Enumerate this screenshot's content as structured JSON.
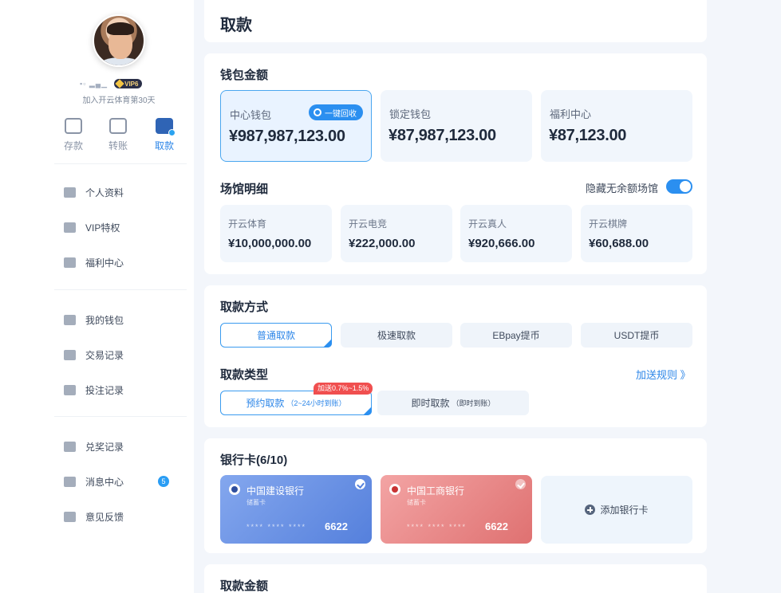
{
  "profile": {
    "username": "▪▫ ▂▄▁",
    "vip_label": "VIP6",
    "join_text": "加入开云体育第30天"
  },
  "quick_actions": [
    {
      "label": "存款",
      "icon": "wallet-deposit-icon",
      "active": false
    },
    {
      "label": "转账",
      "icon": "transfer-icon",
      "active": false
    },
    {
      "label": "取款",
      "icon": "withdraw-card-icon",
      "active": true
    }
  ],
  "menu": {
    "group1": [
      {
        "label": "个人资料",
        "icon": "id-card-icon"
      },
      {
        "label": "VIP特权",
        "icon": "vip-heart-icon"
      },
      {
        "label": "福利中心",
        "icon": "gift-icon"
      }
    ],
    "group2": [
      {
        "label": "我的钱包",
        "icon": "piggy-bank-icon"
      },
      {
        "label": "交易记录",
        "icon": "transaction-doc-icon"
      },
      {
        "label": "投注记录",
        "icon": "bet-record-icon"
      }
    ],
    "group3": [
      {
        "label": "兑奖记录",
        "icon": "redeem-icon"
      },
      {
        "label": "消息中心",
        "icon": "megaphone-icon",
        "badge": "5"
      },
      {
        "label": "意见反馈",
        "icon": "feedback-icon"
      }
    ]
  },
  "page": {
    "title": "取款"
  },
  "wallet": {
    "section_title": "钱包金额",
    "recall_label": "一键回收",
    "items": [
      {
        "label": "中心钱包",
        "amount": "¥987,987,123.00"
      },
      {
        "label": "锁定钱包",
        "amount": "¥87,987,123.00"
      },
      {
        "label": "福利中心",
        "amount": "¥87,123.00"
      }
    ]
  },
  "venues": {
    "section_title": "场馆明细",
    "toggle_label": "隐藏无余额场馆",
    "toggle_on": true,
    "items": [
      {
        "label": "开云体育",
        "amount": "¥10,000,000.00"
      },
      {
        "label": "开云电竞",
        "amount": "¥222,000.00"
      },
      {
        "label": "开云真人",
        "amount": "¥920,666.00"
      },
      {
        "label": "开云棋牌",
        "amount": "¥60,688.00"
      }
    ]
  },
  "withdraw_method": {
    "section_title": "取款方式",
    "options": [
      "普通取款",
      "极速取款",
      "EBpay提币",
      "USDT提币"
    ],
    "selected": 0
  },
  "withdraw_type": {
    "section_title": "取款类型",
    "rule_link": "加送规则 》",
    "promo": "加送0.7%~1.5%",
    "options": [
      {
        "label": "预约取款",
        "sub": "（2~24小时到账）"
      },
      {
        "label": "即时取款",
        "sub": "（即时到账）"
      }
    ],
    "selected": 0
  },
  "bank_cards": {
    "section_title": "银行卡(6/10)",
    "cards": [
      {
        "bank": "中国建设银行",
        "type": "储蓄卡",
        "masked": "**** **** ****",
        "last4": "6622"
      },
      {
        "bank": "中国工商银行",
        "type": "储蓄卡",
        "masked": "**** **** ****",
        "last4": "6622"
      }
    ],
    "add_label": "添加银行卡"
  },
  "amount_section": {
    "title": "取款金额"
  },
  "colors": {
    "accent": "#2b8ff0",
    "promo": "#f04f4f",
    "ccb_card": "#5580dc",
    "icbc_card": "#df7171"
  }
}
